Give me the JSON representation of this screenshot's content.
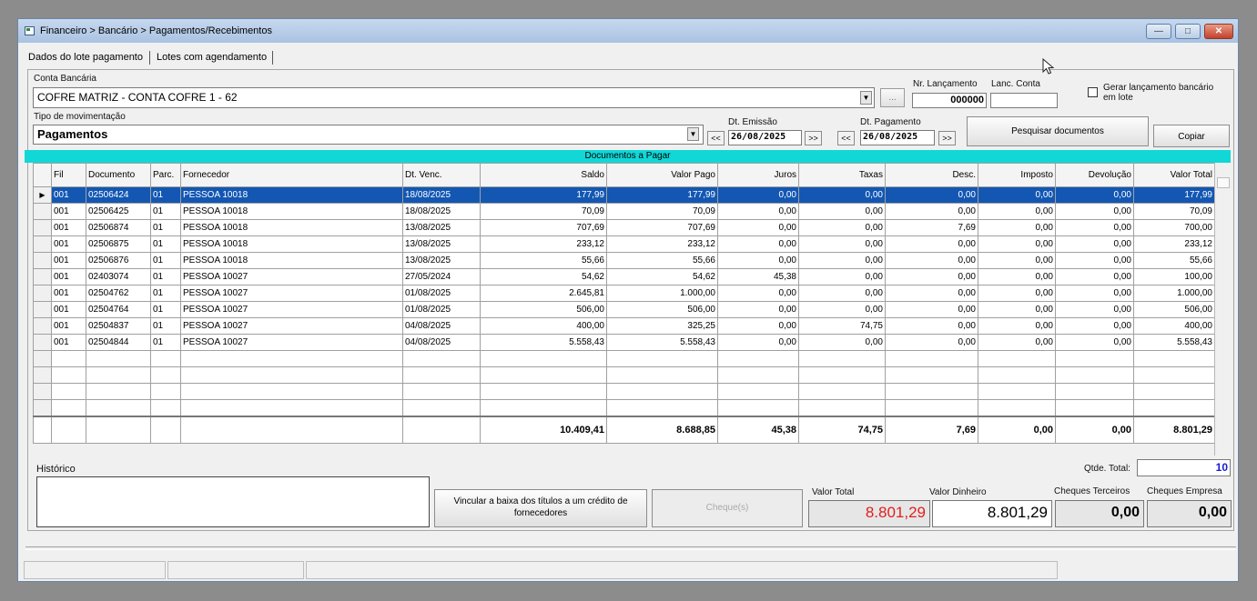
{
  "window": {
    "title": "Financeiro > Bancário > Pagamentos/Recebimentos",
    "min_glyph": "—",
    "max_glyph": "□",
    "close_glyph": "✕"
  },
  "tabs": [
    {
      "label": "Dados do lote pagamento"
    },
    {
      "label": "Lotes com agendamento"
    }
  ],
  "form": {
    "conta_label": "Conta Bancária",
    "conta_value": "COFRE MATRIZ - CONTA COFRE 1 - 62",
    "ellipsis_label": "...",
    "nr_lancamento_label": "Nr. Lançamento",
    "nr_lancamento_value": "000000",
    "lanc_conta_label": "Lanc. Conta",
    "lanc_conta_value": "",
    "gerar_label": "Gerar lançamento bancário em lote",
    "gerar_checked": false,
    "tipo_label": "Tipo de movimentação",
    "tipo_value": "Pagamentos",
    "dt_emissao_label": "Dt. Emissão",
    "dt_emissao_value": "26/08/2025",
    "dt_pagamento_label": "Dt. Pagamento",
    "dt_pagamento_value": "26/08/2025",
    "prev_label": "<<",
    "next_label": ">>",
    "pesquisar_label": "Pesquisar documentos",
    "copiar_label": "Copiar"
  },
  "grid": {
    "title": "Documentos a Pagar",
    "columns": [
      "Fil",
      "Documento",
      "Parc.",
      "Fornecedor",
      "Dt. Venc.",
      "Saldo",
      "Valor Pago",
      "Juros",
      "Taxas",
      "Desc.",
      "Imposto",
      "Devolução",
      "Valor Total"
    ],
    "rows": [
      [
        "001",
        "02506424",
        "01",
        "PESSOA 10018",
        "18/08/2025",
        "177,99",
        "177,99",
        "0,00",
        "0,00",
        "0,00",
        "0,00",
        "0,00",
        "177,99"
      ],
      [
        "001",
        "02506425",
        "01",
        "PESSOA 10018",
        "18/08/2025",
        "70,09",
        "70,09",
        "0,00",
        "0,00",
        "0,00",
        "0,00",
        "0,00",
        "70,09"
      ],
      [
        "001",
        "02506874",
        "01",
        "PESSOA 10018",
        "13/08/2025",
        "707,69",
        "707,69",
        "0,00",
        "0,00",
        "7,69",
        "0,00",
        "0,00",
        "700,00"
      ],
      [
        "001",
        "02506875",
        "01",
        "PESSOA 10018",
        "13/08/2025",
        "233,12",
        "233,12",
        "0,00",
        "0,00",
        "0,00",
        "0,00",
        "0,00",
        "233,12"
      ],
      [
        "001",
        "02506876",
        "01",
        "PESSOA 10018",
        "13/08/2025",
        "55,66",
        "55,66",
        "0,00",
        "0,00",
        "0,00",
        "0,00",
        "0,00",
        "55,66"
      ],
      [
        "001",
        "02403074",
        "01",
        "PESSOA 10027",
        "27/05/2024",
        "54,62",
        "54,62",
        "45,38",
        "0,00",
        "0,00",
        "0,00",
        "0,00",
        "100,00"
      ],
      [
        "001",
        "02504762",
        "01",
        "PESSOA 10027",
        "01/08/2025",
        "2.645,81",
        "1.000,00",
        "0,00",
        "0,00",
        "0,00",
        "0,00",
        "0,00",
        "1.000,00"
      ],
      [
        "001",
        "02504764",
        "01",
        "PESSOA 10027",
        "01/08/2025",
        "506,00",
        "506,00",
        "0,00",
        "0,00",
        "0,00",
        "0,00",
        "0,00",
        "506,00"
      ],
      [
        "001",
        "02504837",
        "01",
        "PESSOA 10027",
        "04/08/2025",
        "400,00",
        "325,25",
        "0,00",
        "74,75",
        "0,00",
        "0,00",
        "0,00",
        "400,00"
      ],
      [
        "001",
        "02504844",
        "01",
        "PESSOA 10027",
        "04/08/2025",
        "5.558,43",
        "5.558,43",
        "0,00",
        "0,00",
        "0,00",
        "0,00",
        "0,00",
        "5.558,43"
      ]
    ],
    "empty_rows": 4,
    "selected_row": 0,
    "selected_marker": "▶",
    "totals": [
      "",
      "",
      "",
      "",
      "",
      "10.409,41",
      "8.688,85",
      "45,38",
      "74,75",
      "7,69",
      "0,00",
      "0,00",
      "8.801,29"
    ]
  },
  "bottom": {
    "historico_label": "Histórico",
    "historico_value": "",
    "qtde_total_label": "Qtde. Total:",
    "qtde_total_value": "10",
    "vincular_label": "Vincular a baixa dos títulos a um crédito de fornecedores",
    "cheques_label": "Cheque(s)",
    "valor_total_label": "Valor Total",
    "valor_total_value": "8.801,29",
    "valor_dinheiro_label": "Valor Dinheiro",
    "valor_dinheiro_value": "8.801,29",
    "cheques_terceiros_label": "Cheques Terceiros",
    "cheques_terceiros_value": "0,00",
    "cheques_empresa_label": "Cheques Empresa",
    "cheques_empresa_value": "0,00"
  },
  "colors": {
    "selection": "#1357b3",
    "header_bar": "#11d7d7",
    "valor_total_text": "#e02020",
    "qtde_text": "#1a1ad8"
  }
}
